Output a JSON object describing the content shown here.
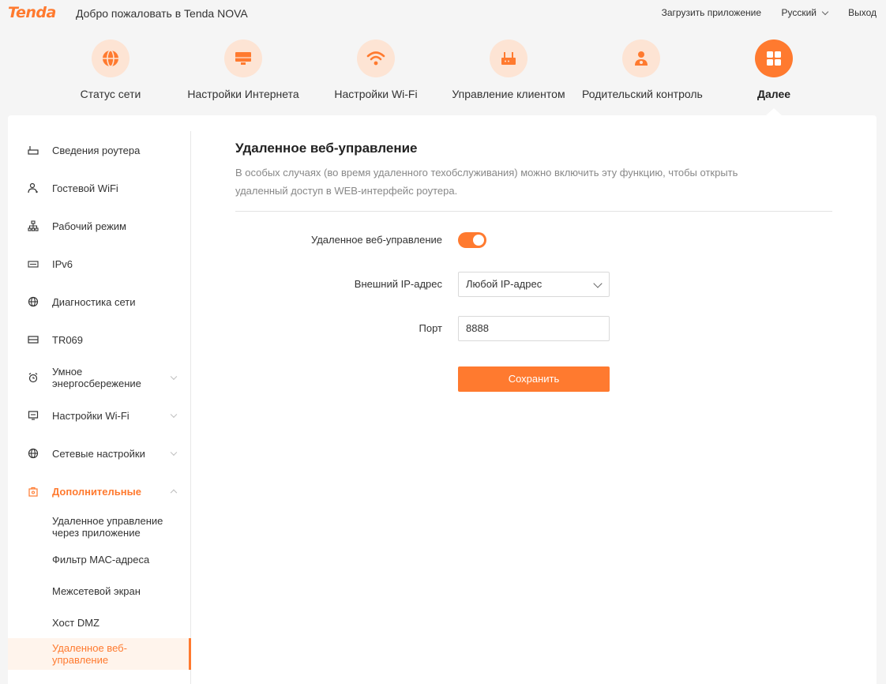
{
  "header": {
    "logo": "Tenda",
    "welcome": "Добро пожаловать в Tenda NOVA",
    "download_app": "Загрузить приложение",
    "language": "Русский",
    "logout": "Выход"
  },
  "nav": {
    "items": [
      {
        "label": "Статус сети",
        "icon": "globe-icon"
      },
      {
        "label": "Настройки Интернета",
        "icon": "monitor-icon"
      },
      {
        "label": "Настройки Wi-Fi",
        "icon": "wifi-icon"
      },
      {
        "label": "Управление клиентом",
        "icon": "router-icon"
      },
      {
        "label": "Родительский контроль",
        "icon": "parent-icon"
      },
      {
        "label": "Далее",
        "icon": "grid-icon"
      }
    ],
    "active": "Далее"
  },
  "sidebar": {
    "items": [
      {
        "label": "Сведения роутера",
        "icon": "router-info-icon"
      },
      {
        "label": "Гостевой WiFi",
        "icon": "guest-icon"
      },
      {
        "label": "Рабочий режим",
        "icon": "topology-icon"
      },
      {
        "label": "IPv6",
        "icon": "ipv6-icon"
      },
      {
        "label": "Диагностика сети",
        "icon": "globe-icon"
      },
      {
        "label": "TR069",
        "icon": "tr069-icon"
      },
      {
        "label": "Умное энергосбережение",
        "icon": "alarm-icon"
      },
      {
        "label": "Настройки Wi-Fi",
        "icon": "wifi-settings-icon"
      },
      {
        "label": "Сетевые настройки",
        "icon": "globe-icon"
      },
      {
        "label": "Дополнительные",
        "icon": "bag-icon"
      }
    ],
    "sub_items": [
      {
        "label": "Удаленное управление через приложение"
      },
      {
        "label": "Фильтр МАС-адреса"
      },
      {
        "label": "Межсетевой экран"
      },
      {
        "label": "Хост DMZ"
      },
      {
        "label": "Удаленное веб-управление"
      }
    ]
  },
  "content": {
    "title": "Удаленное веб-управление",
    "description": "В особых случаях (во время удаленного техобслуживания) можно включить эту функцию, чтобы открыть удаленный доступ в WEB-интерфейс роутера.",
    "fields": {
      "remote_web_label": "Удаленное веб-управление",
      "remote_web_enabled": true,
      "external_ip_label": "Внешний IP-адрес",
      "external_ip_value": "Любой IP-адрес",
      "port_label": "Порт",
      "port_value": "8888"
    },
    "save_label": "Сохранить"
  },
  "colors": {
    "accent": "#ff7a2f",
    "accent_light": "#fde4d4"
  }
}
